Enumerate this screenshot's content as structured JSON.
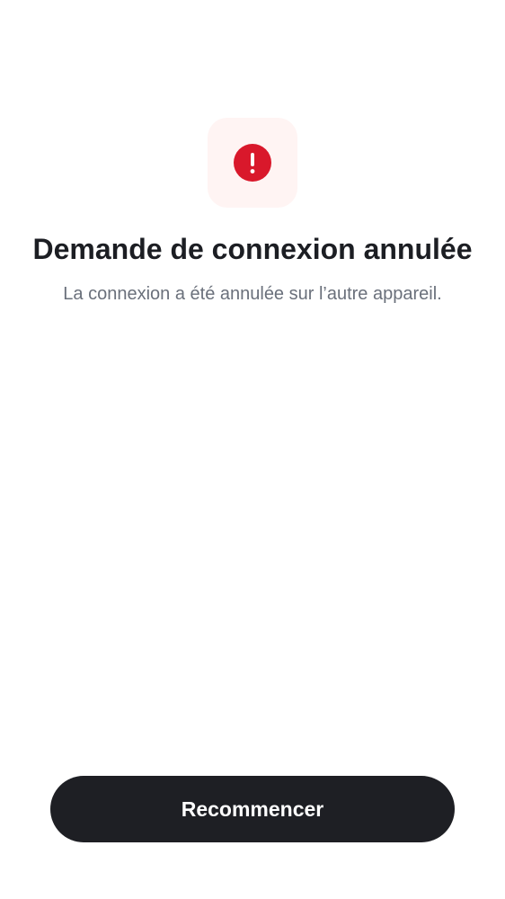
{
  "status": {
    "icon": "exclamation-circle-icon",
    "accent_color": "#d9182b",
    "tile_color": "#fff4f3"
  },
  "title": "Demande de connexion annulée",
  "subtitle": "La connexion a été annulée sur l’autre appareil.",
  "actions": {
    "restart_label": "Recommencer"
  }
}
